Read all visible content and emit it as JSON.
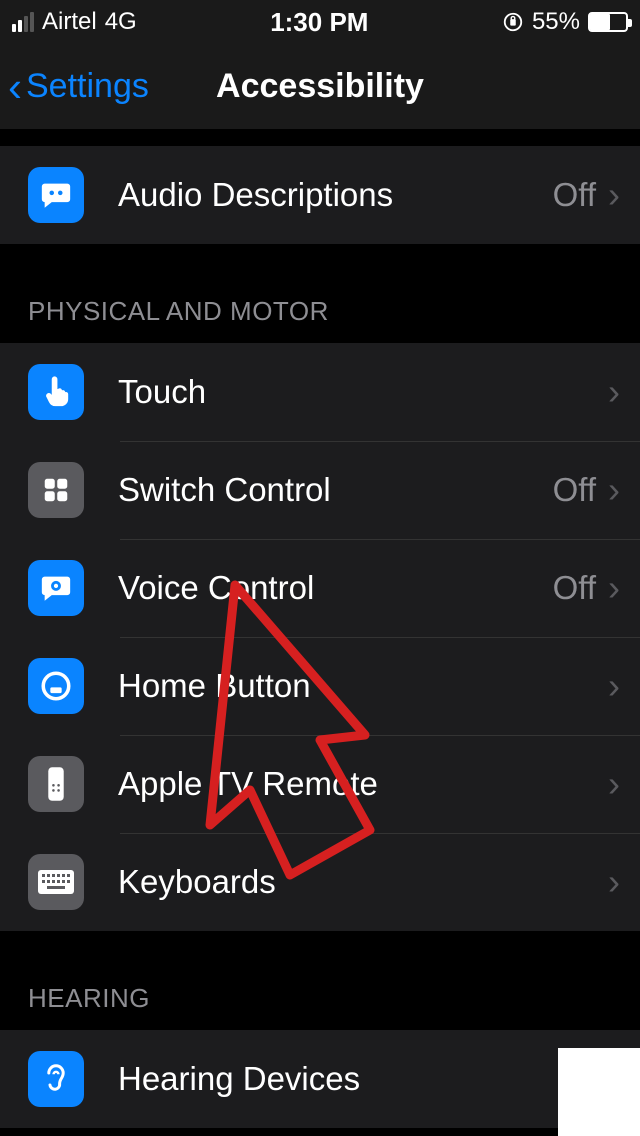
{
  "status": {
    "carrier": "Airtel",
    "network": "4G",
    "time": "1:30 PM",
    "battery_pct": "55%"
  },
  "nav": {
    "back_label": "Settings",
    "title": "Accessibility"
  },
  "groups": [
    {
      "header": null,
      "rows": [
        {
          "icon": "speech-bubble-icon",
          "label": "Audio Descriptions",
          "detail": "Off"
        }
      ]
    },
    {
      "header": "PHYSICAL AND MOTOR",
      "rows": [
        {
          "icon": "touch-icon",
          "label": "Touch",
          "detail": ""
        },
        {
          "icon": "switch-control-icon",
          "label": "Switch Control",
          "detail": "Off"
        },
        {
          "icon": "voice-control-icon",
          "label": "Voice Control",
          "detail": "Off"
        },
        {
          "icon": "home-button-icon",
          "label": "Home Button",
          "detail": ""
        },
        {
          "icon": "remote-icon",
          "label": "Apple TV Remote",
          "detail": ""
        },
        {
          "icon": "keyboard-icon",
          "label": "Keyboards",
          "detail": ""
        }
      ]
    },
    {
      "header": "HEARING",
      "rows": [
        {
          "icon": "ear-icon",
          "label": "Hearing Devices",
          "detail": ""
        }
      ]
    }
  ],
  "annotation": {
    "type": "red-arrow",
    "points_to": "Voice Control"
  }
}
